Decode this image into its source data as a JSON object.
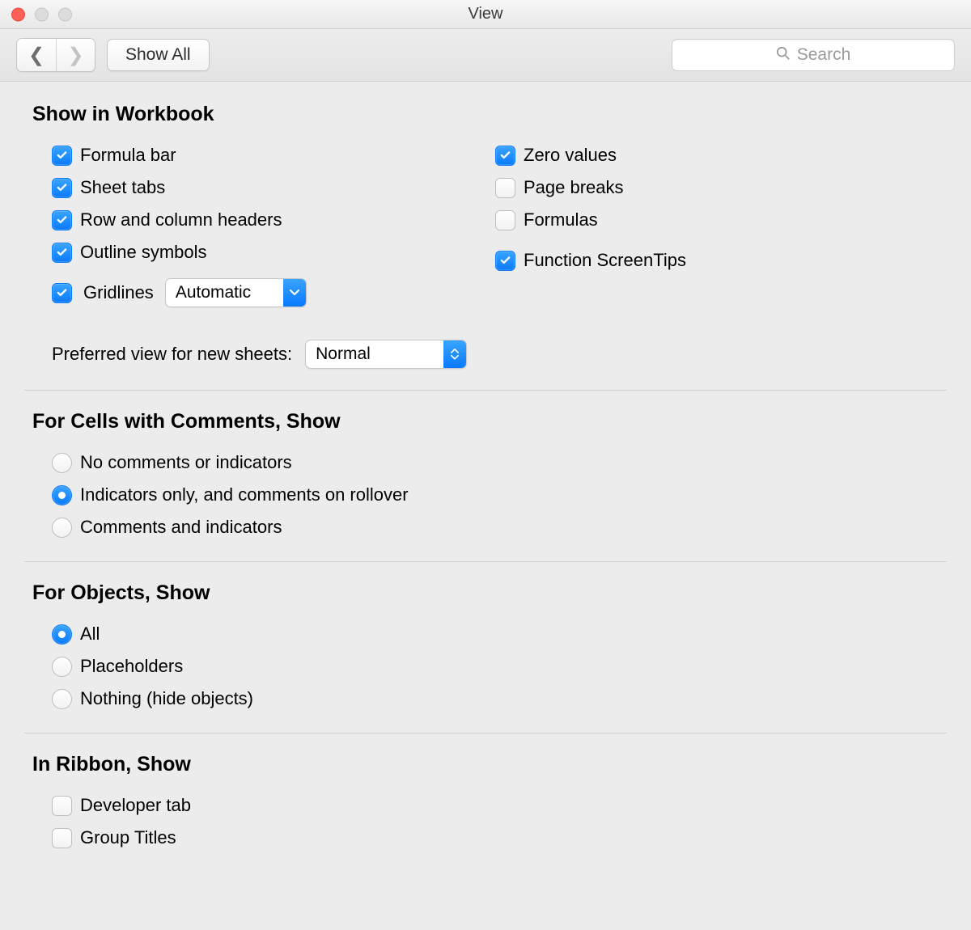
{
  "window": {
    "title": "View"
  },
  "toolbar": {
    "show_all_label": "Show All",
    "search_placeholder": "Search"
  },
  "sections": {
    "show_in_workbook": {
      "title": "Show in Workbook",
      "left": {
        "formula_bar": {
          "label": "Formula bar",
          "checked": true
        },
        "sheet_tabs": {
          "label": "Sheet tabs",
          "checked": true
        },
        "row_col_headers": {
          "label": "Row and column headers",
          "checked": true
        },
        "outline_symbols": {
          "label": "Outline symbols",
          "checked": true
        },
        "gridlines": {
          "label": "Gridlines",
          "checked": true,
          "color": "Automatic"
        }
      },
      "right": {
        "zero_values": {
          "label": "Zero values",
          "checked": true
        },
        "page_breaks": {
          "label": "Page breaks",
          "checked": false
        },
        "formulas": {
          "label": "Formulas",
          "checked": false
        },
        "function_screentips": {
          "label": "Function ScreenTips",
          "checked": true
        }
      },
      "preferred_view_label": "Preferred view for new sheets:",
      "preferred_view_value": "Normal"
    },
    "comments": {
      "title": "For Cells with Comments, Show",
      "options": {
        "none": {
          "label": "No comments or indicators",
          "selected": false
        },
        "indicators": {
          "label": "Indicators only, and comments on rollover",
          "selected": true
        },
        "both": {
          "label": "Comments and indicators",
          "selected": false
        }
      }
    },
    "objects": {
      "title": "For Objects, Show",
      "options": {
        "all": {
          "label": "All",
          "selected": true
        },
        "placeholders": {
          "label": "Placeholders",
          "selected": false
        },
        "nothing": {
          "label": "Nothing (hide objects)",
          "selected": false
        }
      }
    },
    "ribbon": {
      "title": "In Ribbon, Show",
      "developer_tab": {
        "label": "Developer tab",
        "checked": false
      },
      "group_titles": {
        "label": "Group Titles",
        "checked": false
      }
    }
  }
}
